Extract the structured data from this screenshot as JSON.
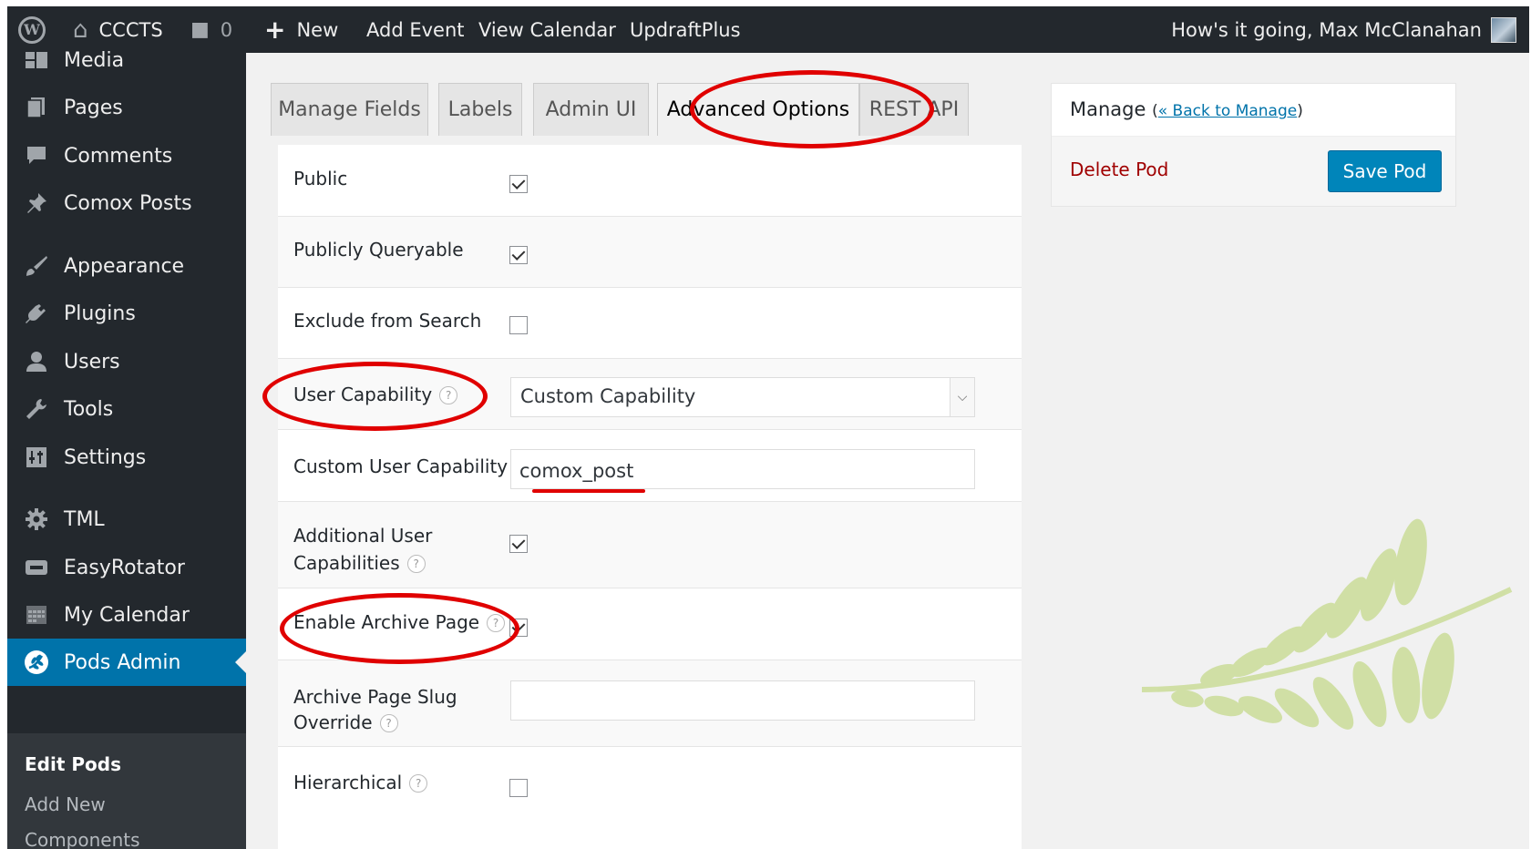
{
  "admin_bar": {
    "site_name": "CCCTS",
    "comment_count": "0",
    "new_label": "New",
    "add_event": "Add Event",
    "view_calendar": "View Calendar",
    "updraftplus": "UpdraftPlus",
    "greeting": "How's it going, Max McClanahan"
  },
  "sidebar": {
    "items": [
      {
        "label": "Media",
        "icon": "media-icon"
      },
      {
        "label": "Pages",
        "icon": "pages-icon"
      },
      {
        "label": "Comments",
        "icon": "comments-icon"
      },
      {
        "label": "Comox Posts",
        "icon": "pin-icon"
      },
      {
        "label": "Appearance",
        "icon": "brush-icon"
      },
      {
        "label": "Plugins",
        "icon": "plugin-icon"
      },
      {
        "label": "Users",
        "icon": "user-icon"
      },
      {
        "label": "Tools",
        "icon": "wrench-icon"
      },
      {
        "label": "Settings",
        "icon": "settings-icon"
      },
      {
        "label": "TML",
        "icon": "gear-icon"
      },
      {
        "label": "EasyRotator",
        "icon": "rotator-icon"
      },
      {
        "label": "My Calendar",
        "icon": "calendar-icon"
      },
      {
        "label": "Pods Admin",
        "icon": "pods-icon"
      }
    ],
    "submenu": [
      "Edit Pods",
      "Add New",
      "Components"
    ]
  },
  "tabs": [
    "Manage Fields",
    "Labels",
    "Admin UI",
    "Advanced Options",
    "REST API"
  ],
  "options": {
    "public": {
      "label": "Public",
      "checked": true
    },
    "publicly_queryable": {
      "label": "Publicly Queryable",
      "checked": true
    },
    "exclude_from_search": {
      "label": "Exclude from Search",
      "checked": false
    },
    "user_capability": {
      "label": "User Capability",
      "value": "Custom Capability"
    },
    "custom_user_capability": {
      "label": "Custom User Capability",
      "value": "comox_post"
    },
    "additional_user_capabilities": {
      "label_line1": "Additional User",
      "label_line2": "Capabilities",
      "checked": true
    },
    "enable_archive_page": {
      "label": "Enable Archive Page",
      "checked": true
    },
    "archive_page_slug_override": {
      "label_line1": "Archive Page Slug",
      "label_line2": "Override",
      "value": ""
    },
    "hierarchical": {
      "label": "Hierarchical",
      "checked": false
    }
  },
  "manage_box": {
    "title": "Manage",
    "back_prefix": "(",
    "back_link": "« Back to Manage",
    "back_suffix": ")",
    "delete_label": "Delete Pod",
    "save_label": "Save Pod"
  },
  "colors": {
    "admin_bar": "#23282d",
    "accent": "#0073aa",
    "annotation": "#e00000",
    "delete": "#a00000"
  }
}
